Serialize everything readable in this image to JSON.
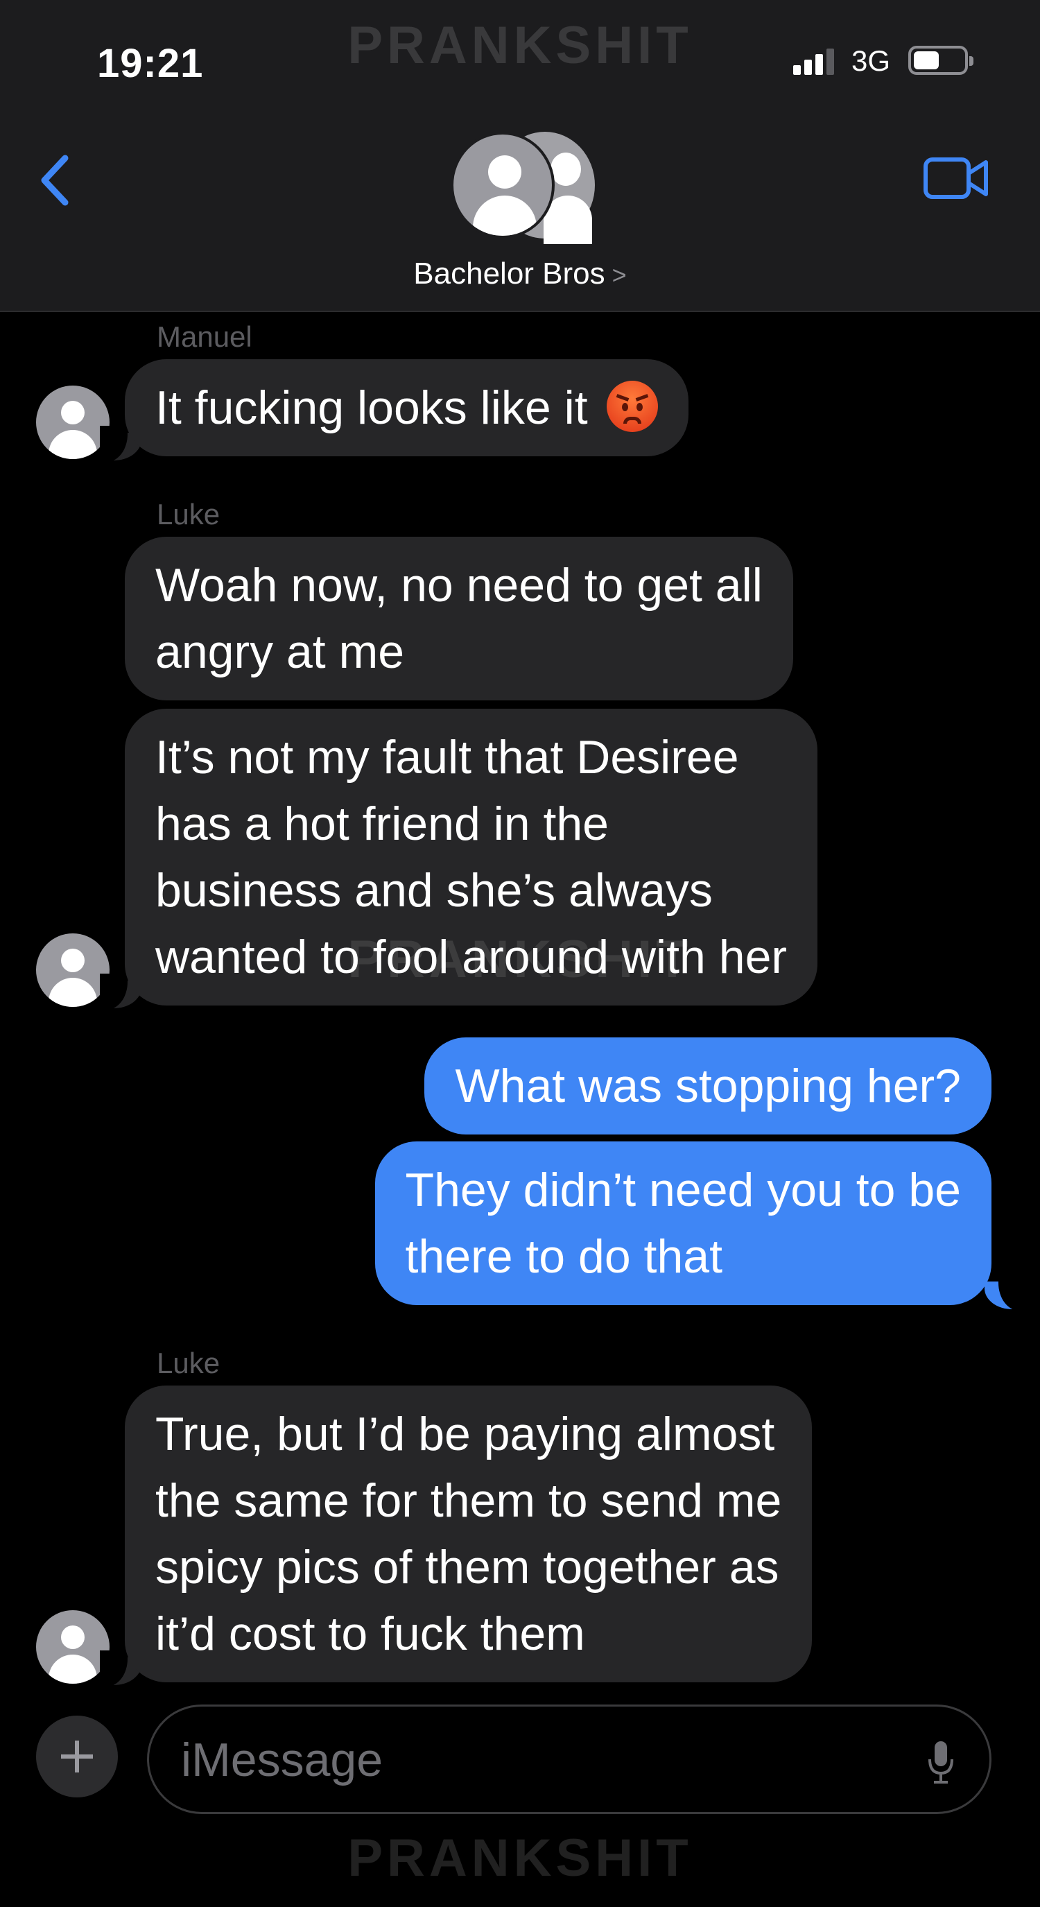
{
  "status_bar": {
    "time": "19:21",
    "network": "3G"
  },
  "watermark": "PRANKSHIT",
  "header": {
    "conversation_name": "Bachelor Bros",
    "chevron": ">"
  },
  "icons": {
    "back": "chevron-left-icon",
    "video": "video-camera-icon",
    "group_avatar": "group-avatar-icon",
    "contact_avatar": "person-icon",
    "emoji": "angry-face-emoji",
    "add": "plus-icon",
    "mic": "microphone-icon"
  },
  "colors": {
    "accent": "#3f86f5",
    "incoming_bubble": "#262628",
    "header_bg": "#1c1c1e"
  },
  "messages": [
    {
      "sender": "Manuel",
      "direction": "incoming",
      "text": "It fucking looks like it",
      "emoji": "😡"
    },
    {
      "sender": "Luke",
      "direction": "incoming",
      "text": "Woah now, no need to get all\nangry at me"
    },
    {
      "sender": "",
      "direction": "incoming",
      "text": "It’s not my fault that Desiree\nhas a hot friend in the\nbusiness and she’s always\nwanted to fool around with her"
    },
    {
      "sender": "",
      "direction": "outgoing",
      "text": "What was stopping her?"
    },
    {
      "sender": "",
      "direction": "outgoing",
      "text": "They didn’t need you to be\nthere to do that"
    },
    {
      "sender": "Luke",
      "direction": "incoming",
      "text": "True, but I’d be paying almost\nthe same for them to send me\nspicy pics of them together as\nit’d cost to fuck them"
    }
  ],
  "composer": {
    "placeholder": "iMessage"
  }
}
